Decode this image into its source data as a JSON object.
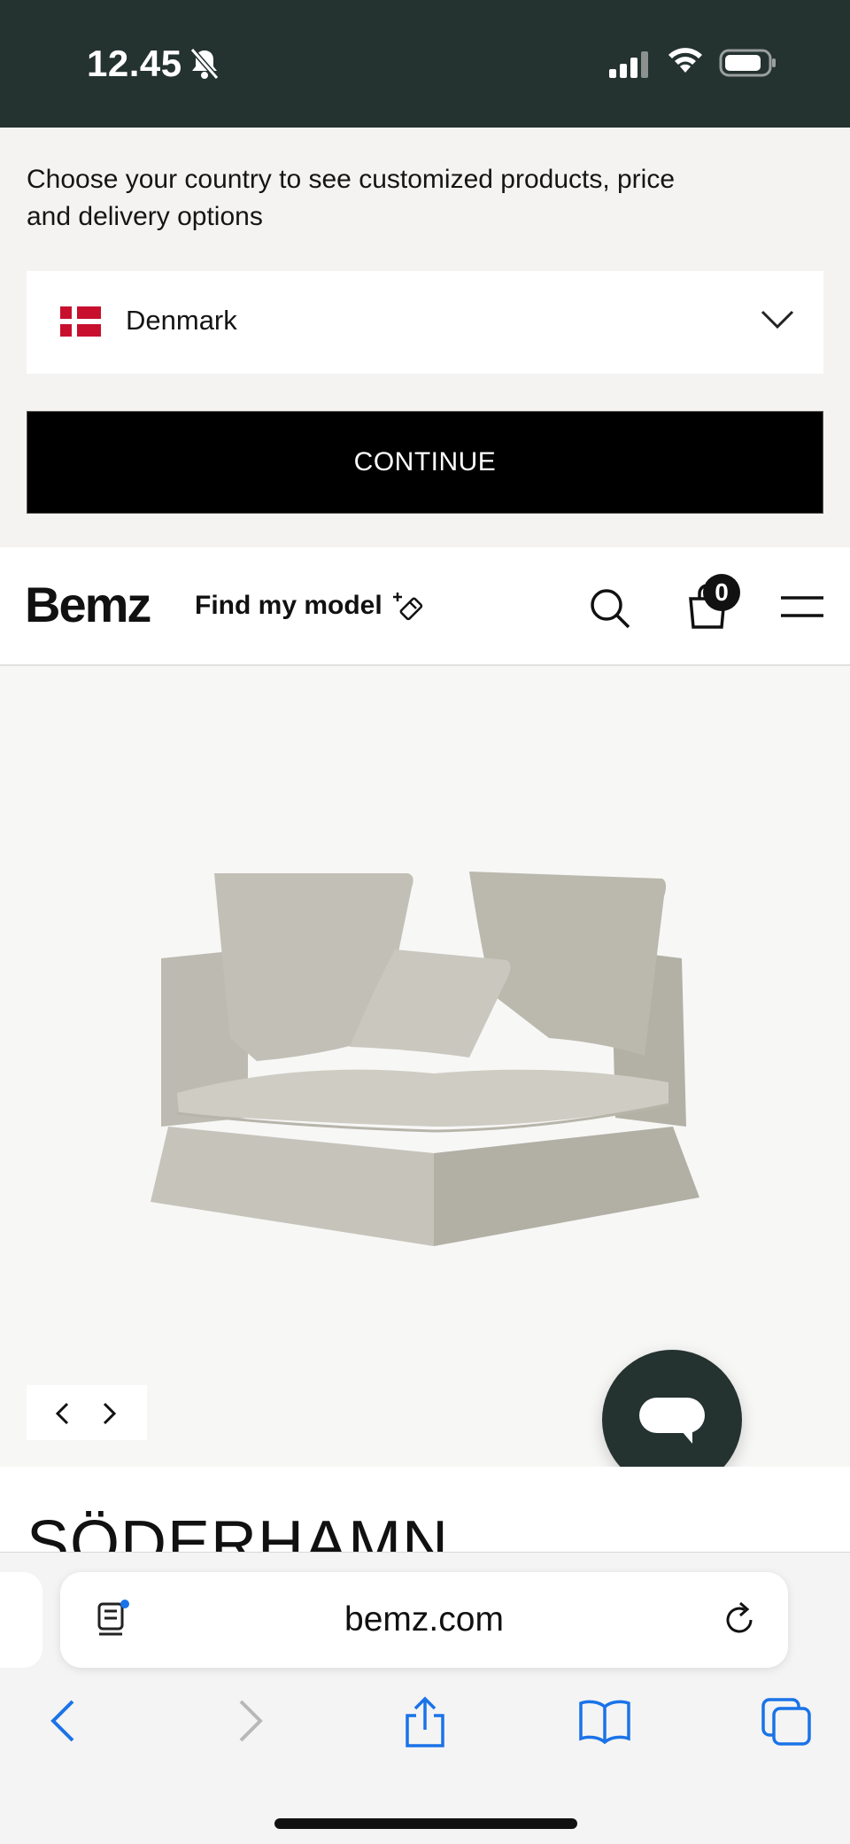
{
  "status_bar": {
    "time": "12.45",
    "icons": [
      "bell-slash-icon",
      "signal-icon",
      "wifi-icon",
      "battery-icon"
    ]
  },
  "country_banner": {
    "prompt": "Choose your country to see customized products, price and delivery options",
    "selected_country": "Denmark",
    "flag": "denmark-flag-icon",
    "continue_label": "CONTINUE"
  },
  "header": {
    "logo": "Bemz",
    "find_model_label": "Find my model",
    "cart_count": "0",
    "icons": [
      "magic-wand-icon",
      "search-icon",
      "cart-icon",
      "menu-icon"
    ]
  },
  "product": {
    "image": "sofa-corner-section-image",
    "title": "SÖDERHAMN"
  },
  "gallery_nav": {
    "icons": [
      "chevron-left-icon",
      "chevron-right-icon"
    ]
  },
  "chat": {
    "icon": "chat-bubble-icon"
  },
  "browser": {
    "url": "bemz.com",
    "toolbar_icons": [
      "back-icon",
      "forward-icon",
      "share-icon",
      "bookmarks-icon",
      "tabs-icon"
    ]
  },
  "colors": {
    "status_bar_bg": "#243230",
    "chat_button_bg": "#243230",
    "accent_blue": "#1a73e8",
    "flag_red": "#c8102e"
  }
}
